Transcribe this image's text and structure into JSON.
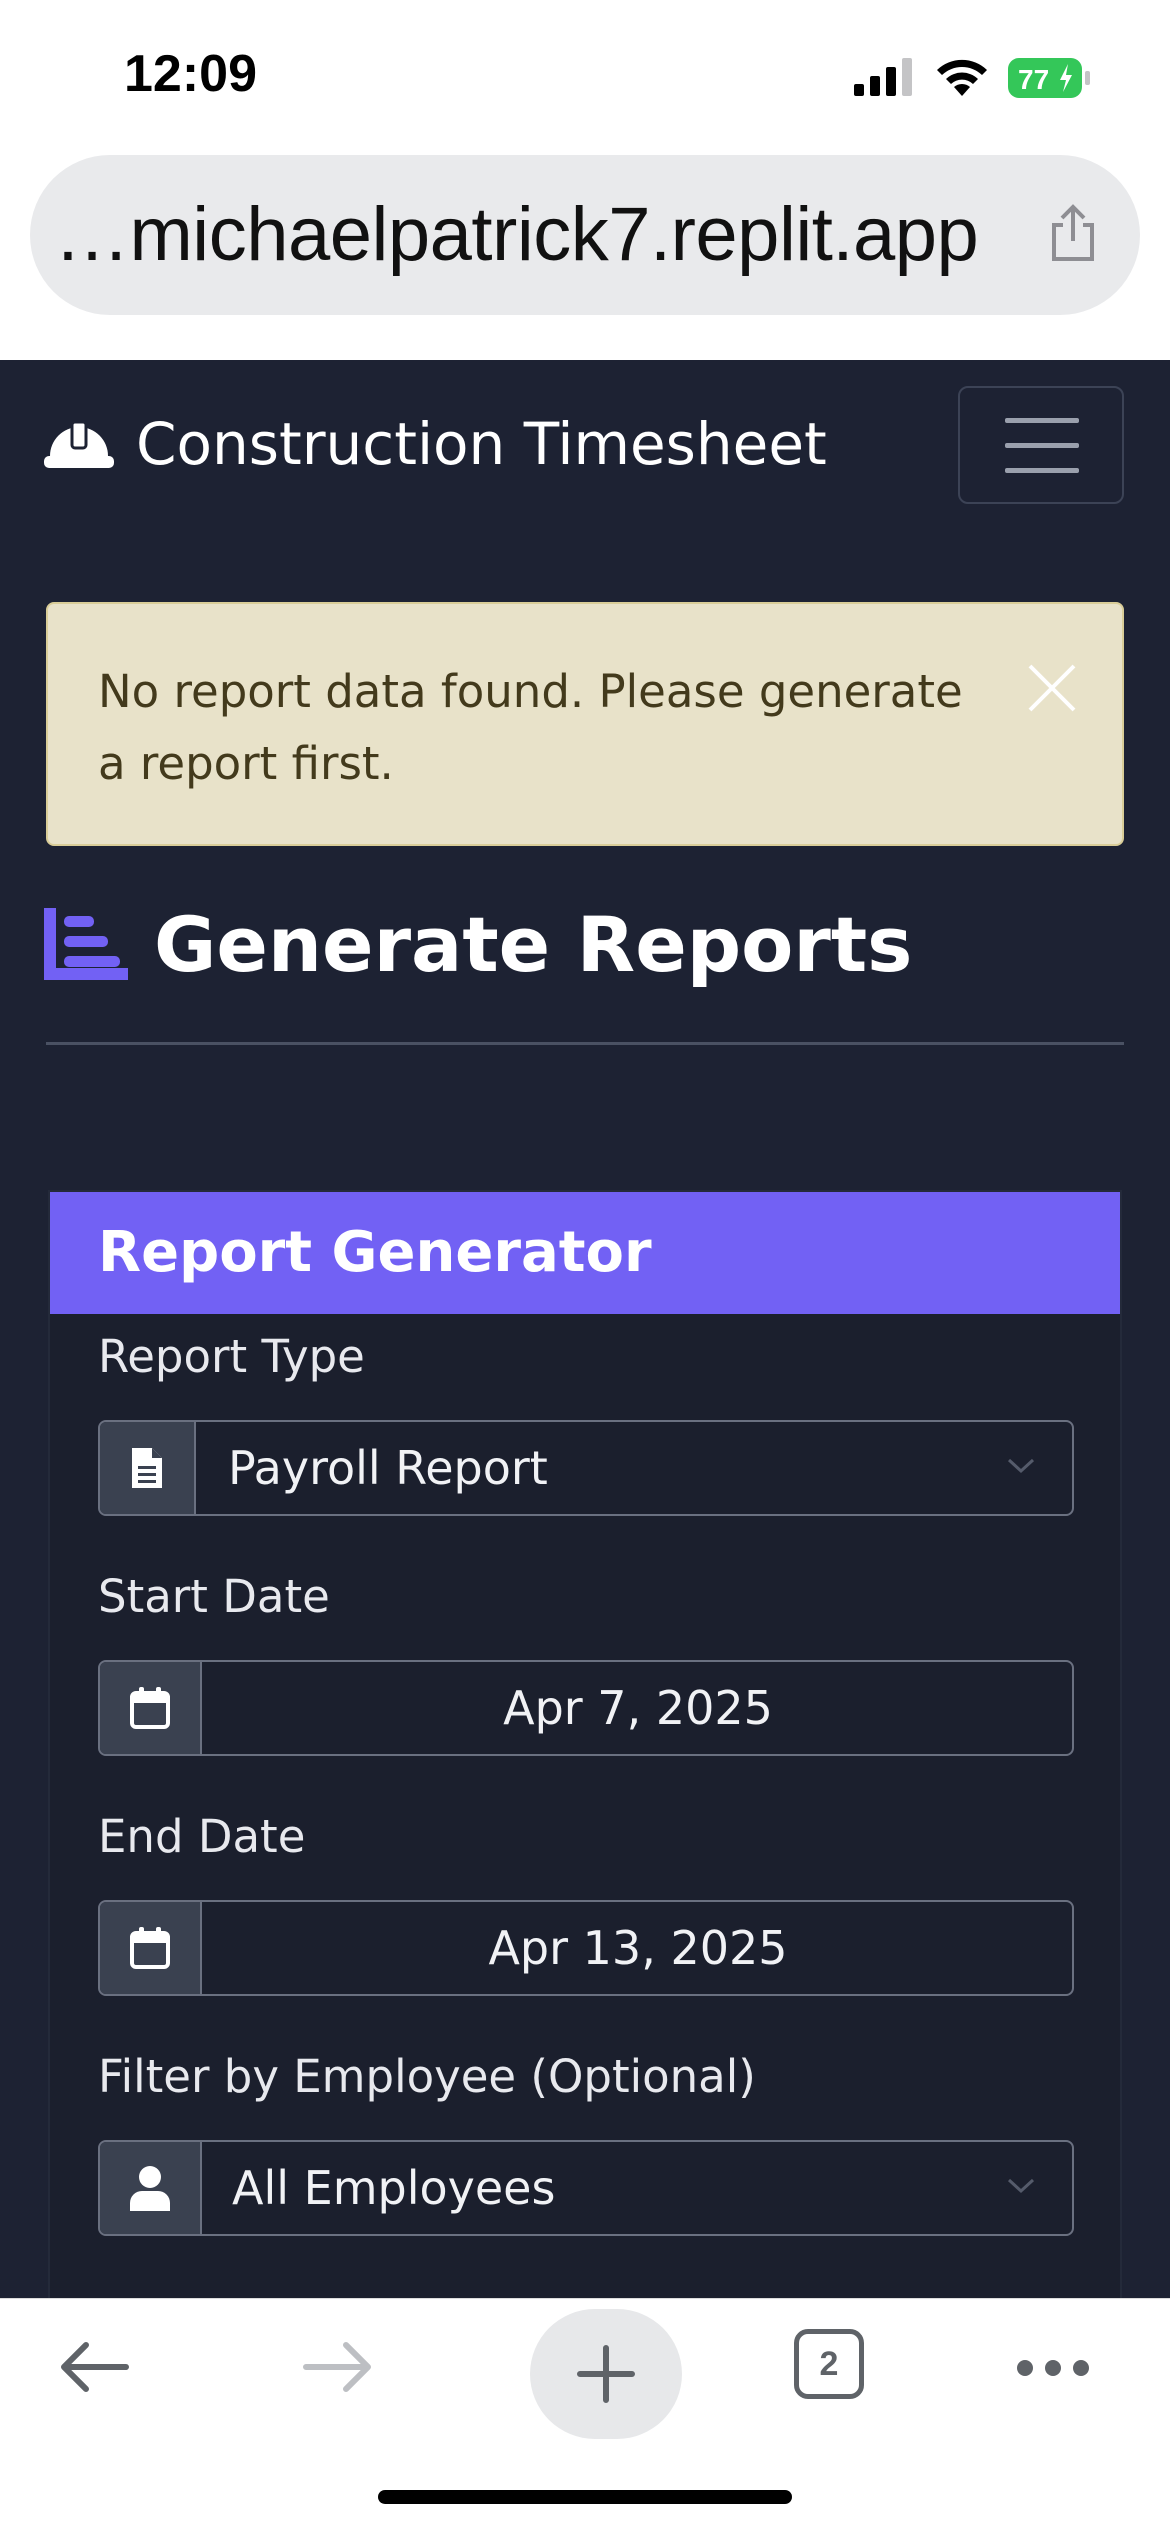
{
  "status_bar": {
    "time": "12:09",
    "battery_level": "77",
    "signal_bars": 3,
    "battery_color": "#34c759"
  },
  "browser": {
    "url": "…michaelpatrick7.replit.app",
    "open_tabs": "2",
    "icons": [
      "back-arrow-icon",
      "forward-arrow-icon",
      "plus-icon",
      "tabs-icon",
      "more-icon",
      "share-icon"
    ]
  },
  "navbar": {
    "brand": "Construction Timesheet",
    "brand_icon": "hard-hat-icon",
    "toggler_icon": "hamburger-icon"
  },
  "alert": {
    "message": "No report data found. Please generate a report first.",
    "close_icon": "close-icon"
  },
  "page": {
    "title": "Generate Reports",
    "title_icon": "chart-bar-icon",
    "accent_color": "#7261f4"
  },
  "report_generator": {
    "title": "Report Generator",
    "fields": {
      "report_type": {
        "label": "Report Type",
        "value": "Payroll Report",
        "icon": "file-icon"
      },
      "start_date": {
        "label": "Start Date",
        "value": "Apr 7, 2025",
        "icon": "calendar-icon"
      },
      "end_date": {
        "label": "End Date",
        "value": "Apr 13, 2025",
        "icon": "calendar-icon"
      },
      "employee": {
        "label": "Filter by Employee (Optional)",
        "value": "All Employees",
        "icon": "user-icon"
      }
    }
  }
}
